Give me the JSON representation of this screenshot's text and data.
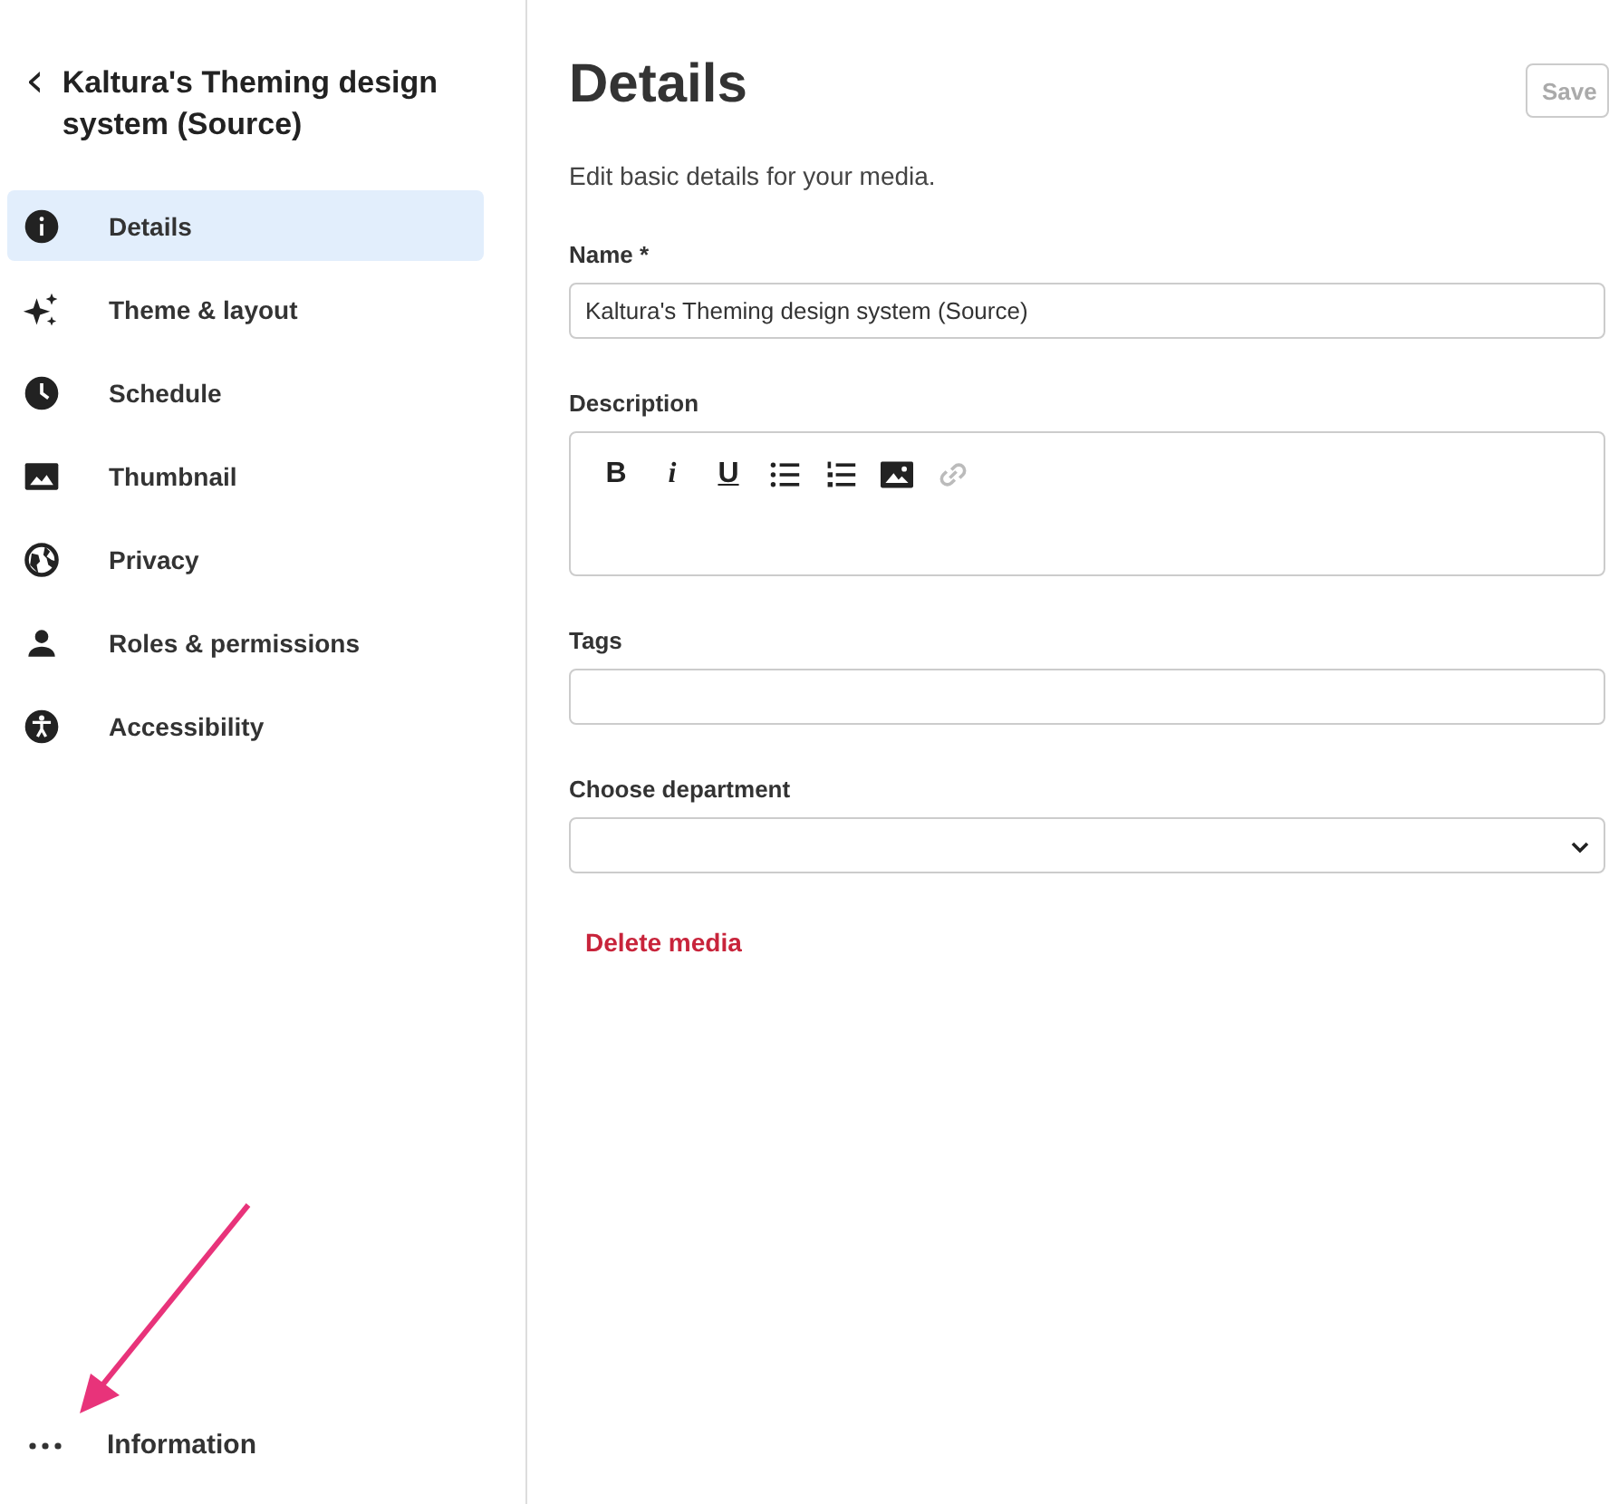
{
  "sidebar": {
    "back_icon": "‹",
    "title": "Kaltura's Theming design system (Source)",
    "items": [
      {
        "label": "Details",
        "selected": true
      },
      {
        "label": "Theme & layout",
        "selected": false
      },
      {
        "label": "Schedule",
        "selected": false
      },
      {
        "label": "Thumbnail",
        "selected": false
      },
      {
        "label": "Privacy",
        "selected": false
      },
      {
        "label": "Roles & permissions",
        "selected": false
      },
      {
        "label": "Accessibility",
        "selected": false
      }
    ],
    "footer": {
      "label": "Information"
    }
  },
  "main": {
    "title": "Details",
    "save_button": "Save",
    "subtitle": "Edit basic details for your media.",
    "name_field": {
      "label": "Name *",
      "value": "Kaltura's Theming design system (Source)"
    },
    "description": {
      "label": "Description",
      "toolbar": [
        {
          "kind": "bold",
          "text": "B",
          "disabled": false
        },
        {
          "kind": "italic",
          "text": "i",
          "disabled": false
        },
        {
          "kind": "underline",
          "text": "U",
          "disabled": false
        },
        {
          "kind": "bullets",
          "disabled": false
        },
        {
          "kind": "numbers",
          "disabled": false
        },
        {
          "kind": "image",
          "disabled": false
        },
        {
          "kind": "link",
          "disabled": true
        }
      ]
    },
    "tags": {
      "label": "Tags"
    },
    "department": {
      "label": "Choose department"
    },
    "delete_link": "Delete media"
  }
}
